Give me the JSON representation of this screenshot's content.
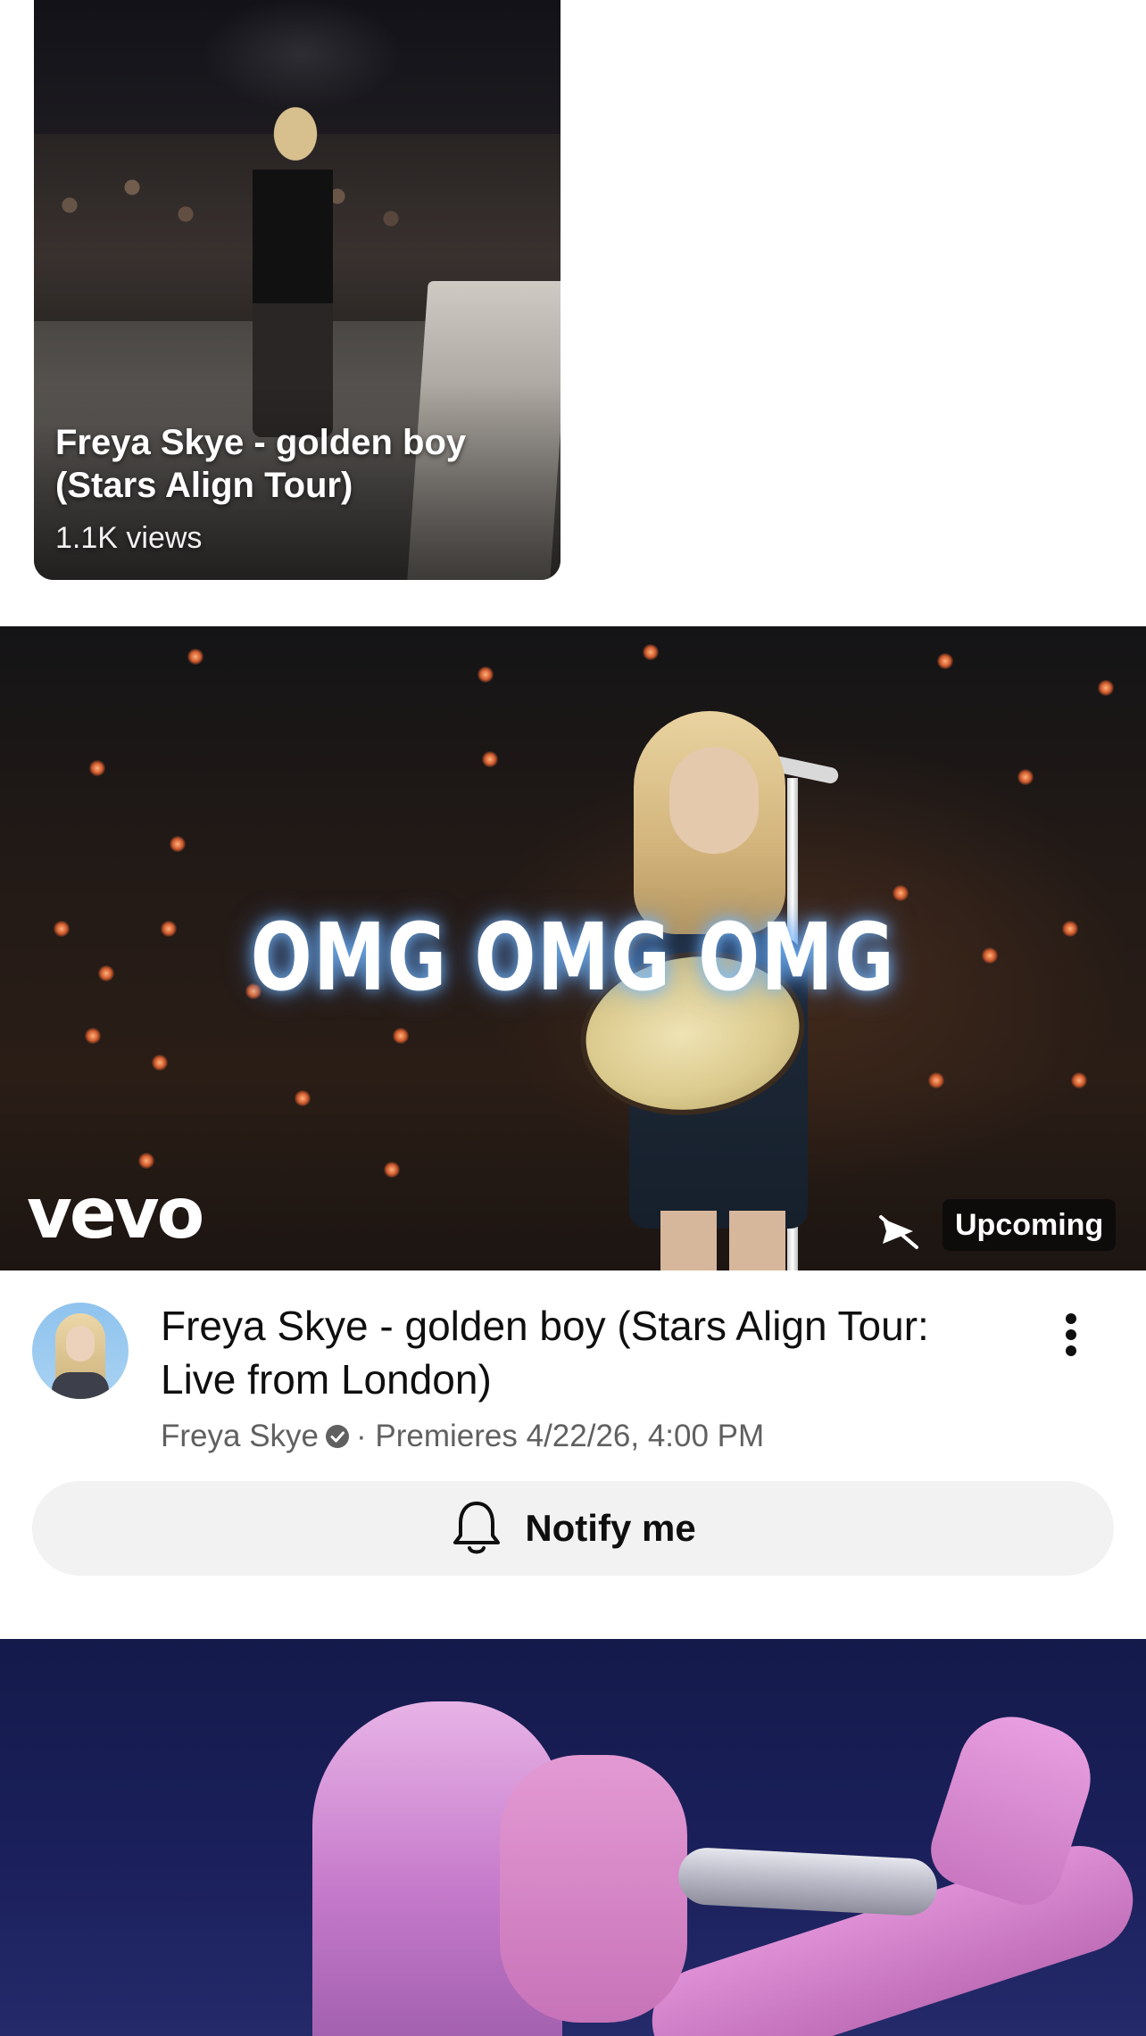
{
  "short": {
    "title": "Freya Skye - golden boy (Stars Align Tour)",
    "views": "1.1K views"
  },
  "featured_video": {
    "overlay_text": "OMG OMG OMG",
    "brand_logo_text": "vevo",
    "status_badge": "Upcoming",
    "title": "Freya Skye - golden boy (Stars Align Tour: Live from London)",
    "channel": "Freya Skye",
    "separator": "·",
    "premiere_text": "Premieres 4/22/26, 4:00 PM",
    "notify_label": "Notify me",
    "icons": {
      "notifications_off": "notifications-off-icon",
      "verified": "verified-badge-icon",
      "more": "more-vertical-icon",
      "bell": "bell-icon"
    }
  },
  "colors": {
    "text_primary": "#0f0f0f",
    "text_secondary": "#606060",
    "button_bg": "#f2f2f2",
    "badge_bg": "#0a0a0a"
  }
}
